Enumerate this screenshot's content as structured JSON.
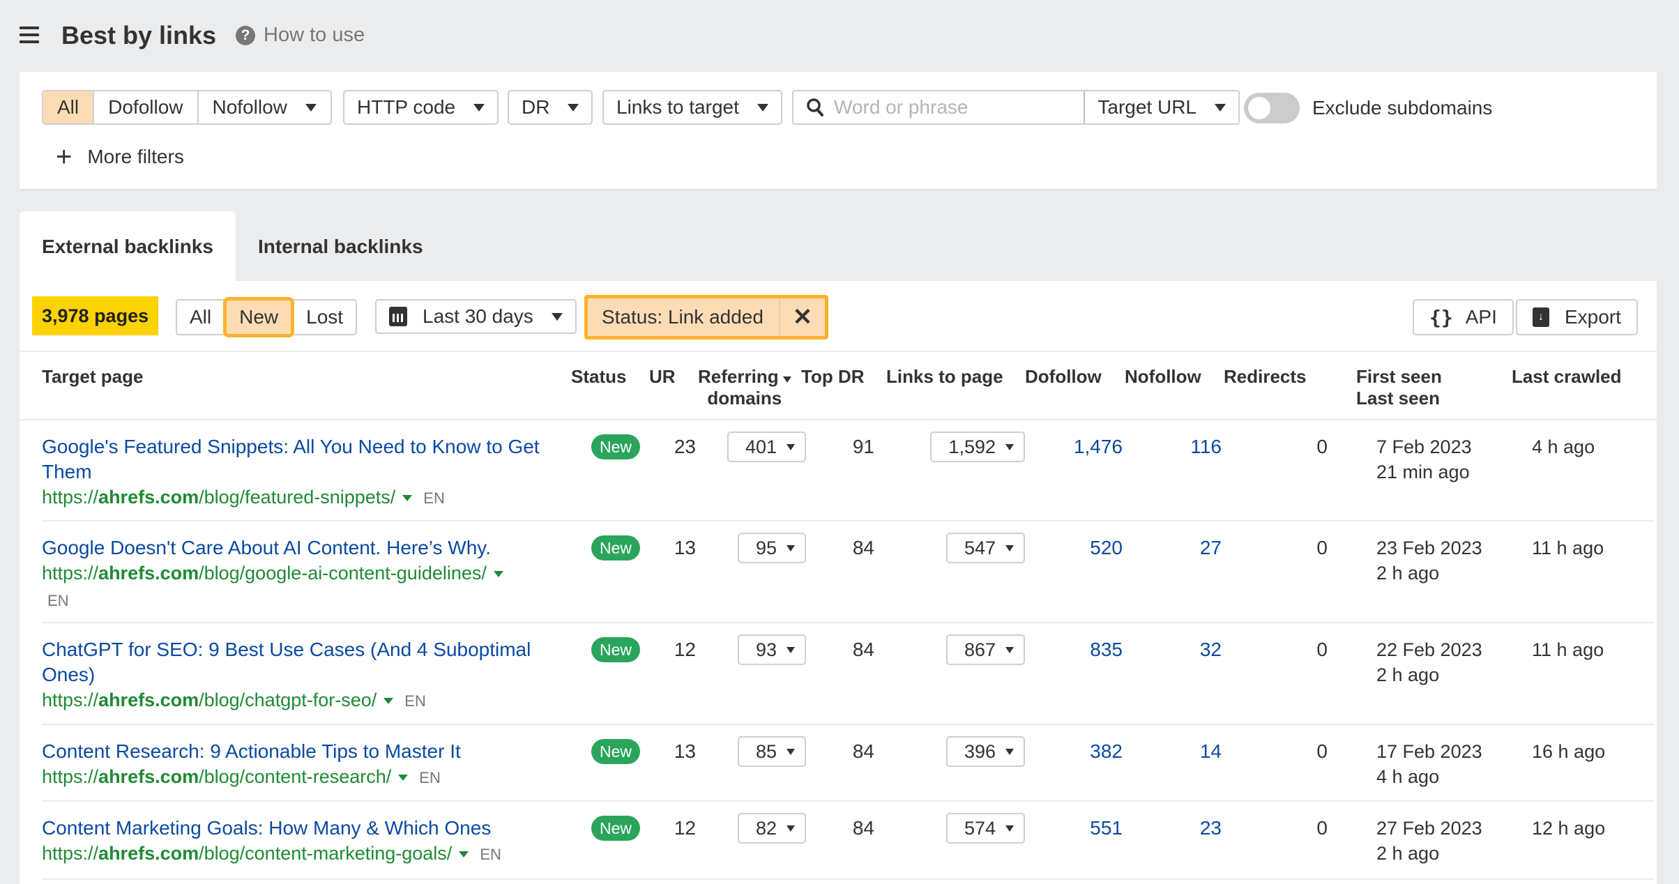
{
  "header": {
    "title": "Best by links",
    "help_label": "How to use",
    "help_icon": "?"
  },
  "filters": {
    "link_type": [
      "All",
      "Dofollow",
      "Nofollow"
    ],
    "link_type_active": "All",
    "http_code": "HTTP code",
    "dr": "DR",
    "links_to_target": "Links to target",
    "search_placeholder": "Word or phrase",
    "search_value": "",
    "target_select": "Target URL",
    "exclude_subdomains_label": "Exclude subdomains",
    "exclude_subdomains_on": false,
    "more_filters": "More filters"
  },
  "tabs": [
    {
      "label": "External backlinks",
      "active": true
    },
    {
      "label": "Internal backlinks",
      "active": false
    }
  ],
  "toolbar": {
    "count": "3,978 pages",
    "status_segments": [
      "All",
      "New",
      "Lost"
    ],
    "status_active": "New",
    "date_range": "Last 30 days",
    "status_filter": "Status: Link added",
    "api_label": "API",
    "export_label": "Export"
  },
  "table": {
    "headers": {
      "target_page": "Target page",
      "status": "Status",
      "ur": "UR",
      "referring": "Referring",
      "referring2": "domains",
      "top_dr": "Top DR",
      "links_to_page": "Links to page",
      "dofollow": "Dofollow",
      "nofollow": "Nofollow",
      "redirects": "Redirects",
      "first_seen": "First seen",
      "last_seen": "Last seen",
      "last_crawled": "Last crawled"
    },
    "rows": [
      {
        "title": "Google's Featured Snippets: All You Need to Know to Get Them",
        "url_prefix": "https://",
        "url_domain": "ahrefs.com",
        "url_path": "/blog/featured-snippets/",
        "lang": "EN",
        "status": "New",
        "ur": "23",
        "referring_domains": "401",
        "top_dr": "91",
        "links_to_page": "1,592",
        "dofollow": "1,476",
        "nofollow": "116",
        "redirects": "0",
        "first_seen": "7 Feb 2023",
        "last_seen": "21 min ago",
        "last_crawled": "4 h ago"
      },
      {
        "title": "Google Doesn't Care About AI Content. Here’s Why.",
        "url_prefix": "https://",
        "url_domain": "ahrefs.com",
        "url_path": "/blog/google-ai-content-guidelines/",
        "lang": "EN",
        "status": "New",
        "ur": "13",
        "referring_domains": "95",
        "top_dr": "84",
        "links_to_page": "547",
        "dofollow": "520",
        "nofollow": "27",
        "redirects": "0",
        "first_seen": "23 Feb 2023",
        "last_seen": "2 h ago",
        "last_crawled": "11 h ago"
      },
      {
        "title": "ChatGPT for SEO: 9 Best Use Cases (And 4 Suboptimal Ones)",
        "url_prefix": "https://",
        "url_domain": "ahrefs.com",
        "url_path": "/blog/chatgpt-for-seo/",
        "lang": "EN",
        "status": "New",
        "ur": "12",
        "referring_domains": "93",
        "top_dr": "84",
        "links_to_page": "867",
        "dofollow": "835",
        "nofollow": "32",
        "redirects": "0",
        "first_seen": "22 Feb 2023",
        "last_seen": "2 h ago",
        "last_crawled": "11 h ago"
      },
      {
        "title": "Content Research: 9 Actionable Tips to Master It",
        "url_prefix": "https://",
        "url_domain": "ahrefs.com",
        "url_path": "/blog/content-research/",
        "lang": "EN",
        "status": "New",
        "ur": "13",
        "referring_domains": "85",
        "top_dr": "84",
        "links_to_page": "396",
        "dofollow": "382",
        "nofollow": "14",
        "redirects": "0",
        "first_seen": "17 Feb 2023",
        "last_seen": "4 h ago",
        "last_crawled": "16 h ago"
      },
      {
        "title": "Content Marketing Goals: How Many & Which Ones",
        "url_prefix": "https://",
        "url_domain": "ahrefs.com",
        "url_path": "/blog/content-marketing-goals/",
        "lang": "EN",
        "status": "New",
        "ur": "12",
        "referring_domains": "82",
        "top_dr": "84",
        "links_to_page": "574",
        "dofollow": "551",
        "nofollow": "23",
        "redirects": "0",
        "first_seen": "27 Feb 2023",
        "last_seen": "2 h ago",
        "last_crawled": "12 h ago"
      }
    ]
  },
  "colors": {
    "accent_highlight": "#fbb22d",
    "active_fill": "#fddcb5",
    "count_badge": "#fcd200",
    "link_blue": "#0b4aa2",
    "url_green": "#1f8a35",
    "new_badge": "#2aa55b"
  }
}
